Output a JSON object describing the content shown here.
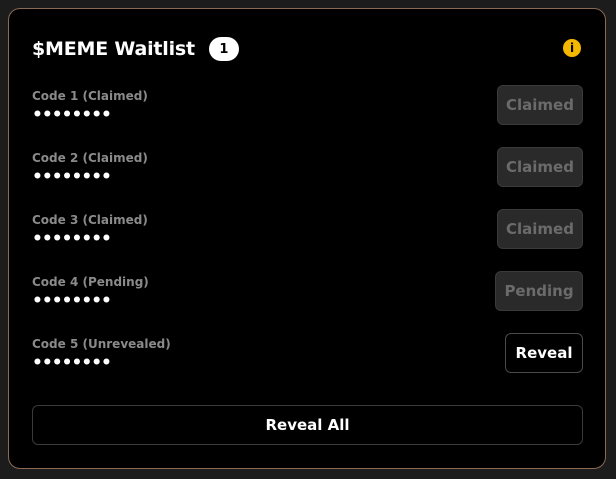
{
  "waitlist": {
    "title": "$MEME Waitlist",
    "count": "1",
    "info_icon": "info-icon",
    "codes": [
      {
        "label": "Code 1 (Claimed)",
        "value": "••••••••",
        "button": "Claimed",
        "state": "disabled"
      },
      {
        "label": "Code 2 (Claimed)",
        "value": "••••••••",
        "button": "Claimed",
        "state": "disabled"
      },
      {
        "label": "Code 3 (Claimed)",
        "value": "••••••••",
        "button": "Claimed",
        "state": "disabled"
      },
      {
        "label": "Code 4 (Pending)",
        "value": "••••••••",
        "button": "Pending",
        "state": "disabled"
      },
      {
        "label": "Code 5 (Unrevealed)",
        "value": "••••••••",
        "button": "Reveal",
        "state": "active"
      }
    ],
    "reveal_all_label": "Reveal All"
  },
  "colors": {
    "background": "#000000",
    "border": "#8a6a55",
    "info_accent": "#f5b800"
  }
}
